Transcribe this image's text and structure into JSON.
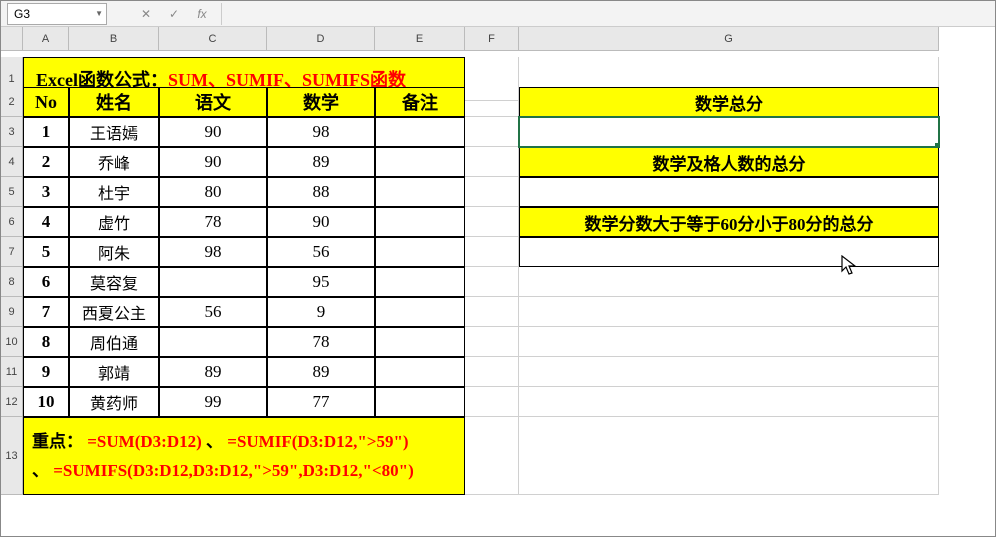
{
  "name_box": "G3",
  "formula_bar": {
    "cancel": "✕",
    "confirm": "✓",
    "fx": "fx",
    "value": ""
  },
  "columns": [
    "A",
    "B",
    "C",
    "D",
    "E",
    "F",
    "G"
  ],
  "row_numbers": [
    "1",
    "2",
    "3",
    "4",
    "5",
    "6",
    "7",
    "8",
    "9",
    "10",
    "11",
    "12",
    "13"
  ],
  "title": {
    "label_black": "Excel函数公式：",
    "label_red": "SUM、SUMIF、SUMIFS函数"
  },
  "headers": {
    "no": "No",
    "name": "姓名",
    "chinese": "语文",
    "math": "数学",
    "note": "备注"
  },
  "rows": [
    {
      "no": "1",
      "name": "王语嫣",
      "chinese": "90",
      "math": "98",
      "note": ""
    },
    {
      "no": "2",
      "name": "乔峰",
      "chinese": "90",
      "math": "89",
      "note": ""
    },
    {
      "no": "3",
      "name": "杜宇",
      "chinese": "80",
      "math": "88",
      "note": ""
    },
    {
      "no": "4",
      "name": "虚竹",
      "chinese": "78",
      "math": "90",
      "note": ""
    },
    {
      "no": "5",
      "name": "阿朱",
      "chinese": "98",
      "math": "56",
      "note": ""
    },
    {
      "no": "6",
      "name": "莫容复",
      "chinese": "",
      "math": "95",
      "note": ""
    },
    {
      "no": "7",
      "name": "西夏公主",
      "chinese": "56",
      "math": "9",
      "note": ""
    },
    {
      "no": "8",
      "name": "周伯通",
      "chinese": "",
      "math": "78",
      "note": ""
    },
    {
      "no": "9",
      "name": "郭靖",
      "chinese": "89",
      "math": "89",
      "note": ""
    },
    {
      "no": "10",
      "name": "黄药师",
      "chinese": "99",
      "math": "77",
      "note": ""
    }
  ],
  "right_panel": {
    "h1": "数学总分",
    "v1": "",
    "h2": "数学及格人数的总分",
    "v2": "",
    "h3": "数学分数大于等于60分小于80分的总分",
    "v3": ""
  },
  "footnote": {
    "prefix": "重点：",
    "f1": "=SUM(D3:D12)",
    "sep": "、",
    "f2": "=SUMIF(D3:D12,\">59\")",
    "f3": "=SUMIFS(D3:D12,D3:D12,\">59\",D3:D12,\"<80\")"
  },
  "chart_data": {
    "type": "table",
    "columns": [
      "No",
      "姓名",
      "语文",
      "数学",
      "备注"
    ],
    "data": [
      [
        1,
        "王语嫣",
        90,
        98,
        null
      ],
      [
        2,
        "乔峰",
        90,
        89,
        null
      ],
      [
        3,
        "杜宇",
        80,
        88,
        null
      ],
      [
        4,
        "虚竹",
        78,
        90,
        null
      ],
      [
        5,
        "阿朱",
        98,
        56,
        null
      ],
      [
        6,
        "莫容复",
        null,
        95,
        null
      ],
      [
        7,
        "西夏公主",
        56,
        9,
        null
      ],
      [
        8,
        "周伯通",
        null,
        78,
        null
      ],
      [
        9,
        "郭靖",
        89,
        89,
        null
      ],
      [
        10,
        "黄药师",
        99,
        77,
        null
      ]
    ],
    "summary_labels": [
      "数学总分",
      "数学及格人数的总分",
      "数学分数大于等于60分小于80分的总分"
    ],
    "formulas": [
      "=SUM(D3:D12)",
      "=SUMIF(D3:D12,\">59\")",
      "=SUMIFS(D3:D12,D3:D12,\">59\",D3:D12,\"<80\")"
    ]
  }
}
